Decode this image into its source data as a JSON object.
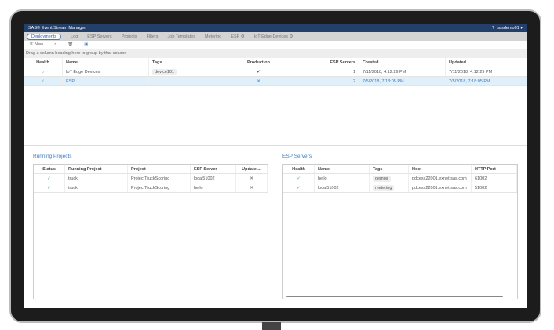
{
  "app": {
    "title": "SAS® Event Stream Manager",
    "user": "sasdemo01 ▾"
  },
  "tabs": [
    "Deployments",
    "Log",
    "ESP Servers",
    "Projects",
    "Filters",
    "Job Templates",
    "Metering",
    "ESP ⚙",
    "IoT Edge Devices ⚙"
  ],
  "toolbar": {
    "new_label": "New"
  },
  "group_hint": "Drag a column heading here to group by that column",
  "deployments": {
    "headers": [
      "Health",
      "Name",
      "Tags",
      "Production",
      "ESP Servers",
      "Created",
      "Updated"
    ],
    "rows": [
      {
        "health": "○",
        "name": "IoT Edge Devices",
        "tag": "device101",
        "production": "✔",
        "servers": "1",
        "created": "7/11/2018, 4:12:29 PM",
        "updated": "7/11/2018, 4:12:29 PM"
      },
      {
        "health": "✓",
        "name": "ESP",
        "tag": "",
        "production": "✕",
        "servers": "2",
        "created": "7/5/2018, 7:18:05 PM",
        "updated": "7/5/2018, 7:18:05 PM"
      }
    ]
  },
  "running": {
    "title": "Running Projects",
    "headers": [
      "Status",
      "Running Project",
      "Project",
      "ESP Server",
      "Update ..."
    ],
    "rows": [
      {
        "status": "✓",
        "rp": "truck",
        "project": "ProjectTruckScoring",
        "server": "local51002",
        "update": "✕"
      },
      {
        "status": "✓",
        "rp": "truck",
        "project": "ProjectTruckScoring",
        "server": "hello",
        "update": "✕"
      }
    ]
  },
  "servers": {
    "title": "ESP Servers",
    "headers": [
      "Health",
      "Name",
      "Tags",
      "Host",
      "HTTP Port"
    ],
    "rows": [
      {
        "health": "✓",
        "name": "hello",
        "tag": "demos",
        "host": "pdcesx22001.exnet.sas.com",
        "port": "61002"
      },
      {
        "health": "✓",
        "name": "local51002",
        "tag": "metering",
        "host": "pdcesx22001.exnet.sas.com",
        "port": "51002"
      }
    ]
  }
}
